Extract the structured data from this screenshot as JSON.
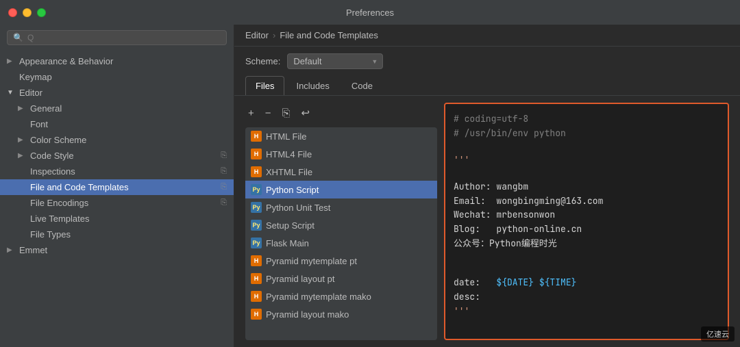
{
  "window": {
    "title": "Preferences",
    "controls": {
      "close": "close",
      "minimize": "minimize",
      "maximize": "maximize"
    }
  },
  "search": {
    "placeholder": "Q"
  },
  "sidebar": {
    "items": [
      {
        "id": "appearance",
        "label": "Appearance & Behavior",
        "indent": 0,
        "hasArrow": true,
        "expanded": false
      },
      {
        "id": "keymap",
        "label": "Keymap",
        "indent": 0,
        "hasArrow": false
      },
      {
        "id": "editor",
        "label": "Editor",
        "indent": 0,
        "hasArrow": true,
        "expanded": true
      },
      {
        "id": "general",
        "label": "General",
        "indent": 1,
        "hasArrow": true,
        "expanded": false
      },
      {
        "id": "font",
        "label": "Font",
        "indent": 1,
        "hasArrow": false
      },
      {
        "id": "color-scheme",
        "label": "Color Scheme",
        "indent": 1,
        "hasArrow": true,
        "expanded": false
      },
      {
        "id": "code-style",
        "label": "Code Style",
        "indent": 1,
        "hasArrow": true,
        "expanded": false,
        "hasCopyIcon": true
      },
      {
        "id": "inspections",
        "label": "Inspections",
        "indent": 1,
        "hasArrow": false,
        "hasCopyIcon": true
      },
      {
        "id": "file-and-code-templates",
        "label": "File and Code Templates",
        "indent": 1,
        "hasArrow": false,
        "selected": true,
        "hasCopyIcon": true
      },
      {
        "id": "file-encodings",
        "label": "File Encodings",
        "indent": 1,
        "hasArrow": false,
        "hasCopyIcon": true
      },
      {
        "id": "live-templates",
        "label": "Live Templates",
        "indent": 1,
        "hasArrow": false
      },
      {
        "id": "file-types",
        "label": "File Types",
        "indent": 1,
        "hasArrow": false
      },
      {
        "id": "emmet",
        "label": "Emmet",
        "indent": 0,
        "hasArrow": true,
        "expanded": false
      }
    ]
  },
  "breadcrumb": {
    "parts": [
      "Editor",
      "File and Code Templates"
    ]
  },
  "scheme": {
    "label": "Scheme:",
    "value": "Default"
  },
  "tabs": [
    {
      "id": "files",
      "label": "Files"
    },
    {
      "id": "includes",
      "label": "Includes",
      "active": true
    },
    {
      "id": "code",
      "label": "Code"
    }
  ],
  "toolbar": {
    "add": "+",
    "remove": "−",
    "copy": "⎘",
    "reset": "↩"
  },
  "file_list": [
    {
      "id": "html-file",
      "label": "HTML File",
      "type": "html"
    },
    {
      "id": "html4-file",
      "label": "HTML4 File",
      "type": "html"
    },
    {
      "id": "xhtml-file",
      "label": "XHTML File",
      "type": "html"
    },
    {
      "id": "python-script",
      "label": "Python Script",
      "type": "python",
      "selected": true
    },
    {
      "id": "python-unit-test",
      "label": "Python Unit Test",
      "type": "python"
    },
    {
      "id": "setup-script",
      "label": "Setup Script",
      "type": "python"
    },
    {
      "id": "flask-main",
      "label": "Flask Main",
      "type": "python"
    },
    {
      "id": "pyramid-mytemplate-pt",
      "label": "Pyramid mytemplate pt",
      "type": "html"
    },
    {
      "id": "pyramid-layout-pt",
      "label": "Pyramid layout pt",
      "type": "html"
    },
    {
      "id": "pyramid-mytemplate-mako",
      "label": "Pyramid mytemplate mako",
      "type": "html"
    },
    {
      "id": "pyramid-layout-mako",
      "label": "Pyramid layout mako",
      "type": "html"
    }
  ],
  "code_content": {
    "lines": [
      {
        "type": "comment",
        "text": "# coding=utf-8"
      },
      {
        "type": "comment",
        "text": "# /usr/bin/env python"
      },
      {
        "type": "blank"
      },
      {
        "type": "string",
        "text": "'''"
      },
      {
        "type": "blank"
      },
      {
        "type": "text",
        "text": "Author: wangbm"
      },
      {
        "type": "text",
        "text": "Email:  wongbingming@163.com"
      },
      {
        "type": "text",
        "text": "Wechat: mrbensonwon"
      },
      {
        "type": "text",
        "text": "Blog:   python-online.cn"
      },
      {
        "type": "text",
        "text": "公众号：Python编程时光"
      },
      {
        "type": "blank"
      },
      {
        "type": "blank"
      },
      {
        "type": "text",
        "text": "date:   ${DATE} ${TIME}"
      },
      {
        "type": "text",
        "text": "desc:"
      },
      {
        "type": "string",
        "text": "'''"
      }
    ]
  },
  "watermark": "亿速云"
}
